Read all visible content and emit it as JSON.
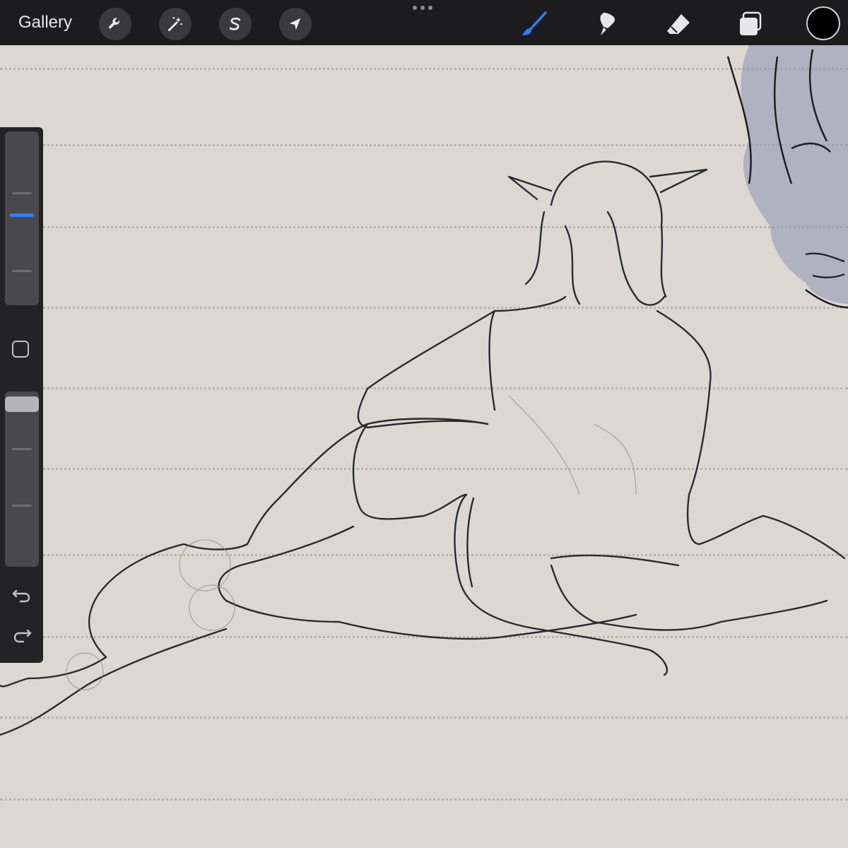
{
  "topbar": {
    "gallery_label": "Gallery",
    "left_tools": [
      {
        "icon": "wrench-icon",
        "name": "actions"
      },
      {
        "icon": "magic-wand-icon",
        "name": "adjustments"
      },
      {
        "icon": "selection-s-icon",
        "name": "selection"
      },
      {
        "icon": "transform-arrow-icon",
        "name": "transform"
      }
    ],
    "right_tools": [
      {
        "icon": "brush-icon",
        "name": "paint",
        "active": true
      },
      {
        "icon": "smudge-icon",
        "name": "smudge",
        "active": false
      },
      {
        "icon": "eraser-icon",
        "name": "erase",
        "active": false
      },
      {
        "icon": "layers-icon",
        "name": "layers",
        "active": false
      }
    ],
    "current_color": "#000000"
  },
  "sidebar": {
    "brush_size_level": 0.52,
    "opacity_level": 0.97,
    "undo_icon": "undo-arrow-icon",
    "redo_icon": "redo-arrow-icon"
  },
  "colors": {
    "accent": "#2f7df6",
    "toolbar_bg": "#1c1c1e",
    "canvas_paper": "#dcd8d1",
    "sketch_ink": "#2a2a2e",
    "face_tint": "#8d93b5"
  }
}
